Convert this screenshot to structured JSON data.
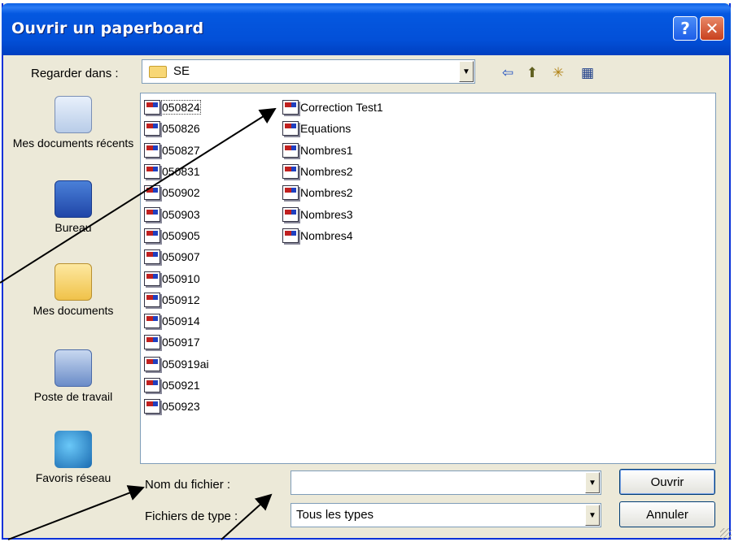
{
  "window": {
    "title": "Ouvrir un paperboard",
    "help_label": "?",
    "close_label": "✕"
  },
  "toolbar": {
    "look_in_label": "Regarder dans :",
    "look_in_value": "SE",
    "dropdown_glyph": "▼",
    "back_glyph": "⇦",
    "up_glyph": "⬆",
    "new_folder_glyph": "✳",
    "views_glyph": "▦"
  },
  "places": [
    {
      "label": "Mes documents récents",
      "icon": "recent-documents-icon"
    },
    {
      "label": "Bureau",
      "icon": "desktop-icon"
    },
    {
      "label": "Mes documents",
      "icon": "my-documents-icon"
    },
    {
      "label": "Poste de travail",
      "icon": "my-computer-icon"
    },
    {
      "label": "Favoris réseau",
      "icon": "network-places-icon"
    }
  ],
  "files_col1": [
    "050824",
    "050826",
    "050827",
    "050831",
    "050902",
    "050903",
    "050905",
    "050907",
    "050910",
    "050912",
    "050914",
    "050917",
    "050919ai",
    "050921",
    "050923"
  ],
  "files_col2": [
    "Correction Test1",
    "Equations",
    "Nombres1",
    "Nombres2",
    "Nombres2",
    "Nombres3",
    "Nombres4"
  ],
  "filename": {
    "label": "Nom du fichier :",
    "value": ""
  },
  "filetype": {
    "label": "Fichiers de type :",
    "value": "Tous les types"
  },
  "buttons": {
    "open": "Ouvrir",
    "cancel": "Annuler"
  },
  "colors": {
    "titlebar": "#0350d8",
    "dialog_bg": "#ece9d8",
    "arrow": "#000000"
  }
}
